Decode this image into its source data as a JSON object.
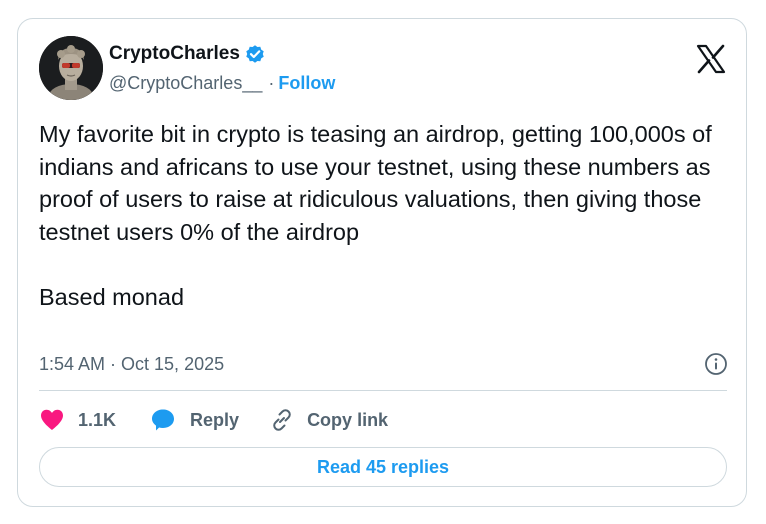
{
  "author": {
    "display_name": "CryptoCharles",
    "handle": "@CryptoCharles__",
    "verified_badge": "verified-check-icon",
    "follow_label": "Follow",
    "separator": "·"
  },
  "tweet": {
    "text": "My favorite bit in crypto is teasing an airdrop, getting 100,000s of indians and africans to use your testnet, using these numbers as proof of users to raise at ridiculous valuations, then giving those testnet users 0% of the airdrop\n\nBased monad",
    "timestamp": "1:54 AM · Oct 15, 2025"
  },
  "actions": {
    "like_count": "1.1K",
    "reply_label": "Reply",
    "copy_link_label": "Copy link",
    "read_replies_label": "Read 45 replies"
  },
  "icons": {
    "platform": "x-logo-icon",
    "like": "heart-icon",
    "reply": "speech-bubble-icon",
    "copy": "link-icon",
    "info": "info-icon"
  },
  "colors": {
    "accent": "#1d9bf0",
    "like": "#f91880",
    "text": "#0f1419",
    "muted": "#536471",
    "border": "#cfd9de"
  }
}
